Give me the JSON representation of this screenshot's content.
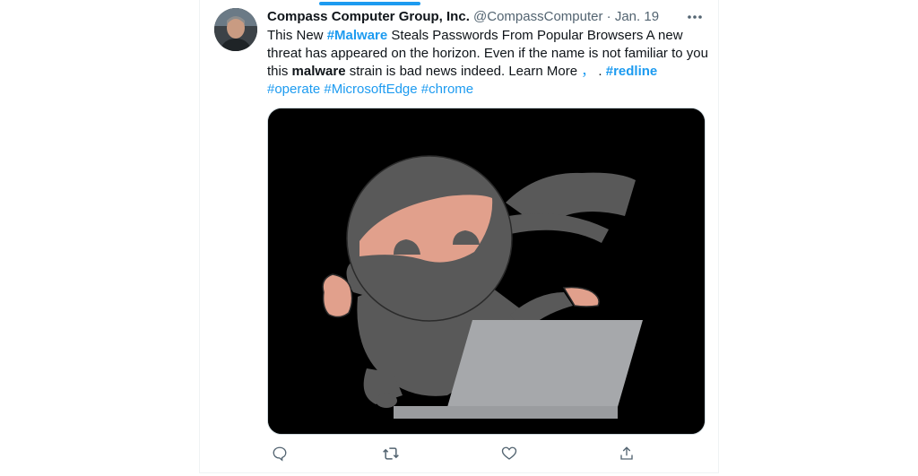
{
  "tweet": {
    "author": {
      "display_name": "Compass Computer Group, Inc.",
      "handle": "@CompassComputer"
    },
    "separator": " · ",
    "date": "Jan. 19",
    "text": {
      "p1": "This New ",
      "tag_malware": "#Malware",
      "p2": " Steals Passwords From Popular Browsers A new threat has appeared on the horizon. Even if the name is not familiar to you this ",
      "bold_malware": "malware",
      "p3": " strain is bad news indeed. Learn More ",
      "link_comma": "，",
      "p4": " . ",
      "tag_redline": "#redline",
      "p5": " ",
      "tag_operate": "#operate",
      "p6": " ",
      "tag_edge": "#MicrosoftEdge",
      "p7": " ",
      "tag_chrome": "#chrome"
    }
  },
  "colors": {
    "accent": "#1d9bf0",
    "secondary_text": "#536471",
    "media_background": "#000000",
    "ninja_gray": "#595959",
    "ninja_skin": "#e1a08c",
    "laptop_gray": "#a6a8ab"
  },
  "icons": {
    "more": "more-horizontal-icon",
    "reply": "reply-icon",
    "retweet": "retweet-icon",
    "like": "heart-icon",
    "share": "share-icon"
  }
}
